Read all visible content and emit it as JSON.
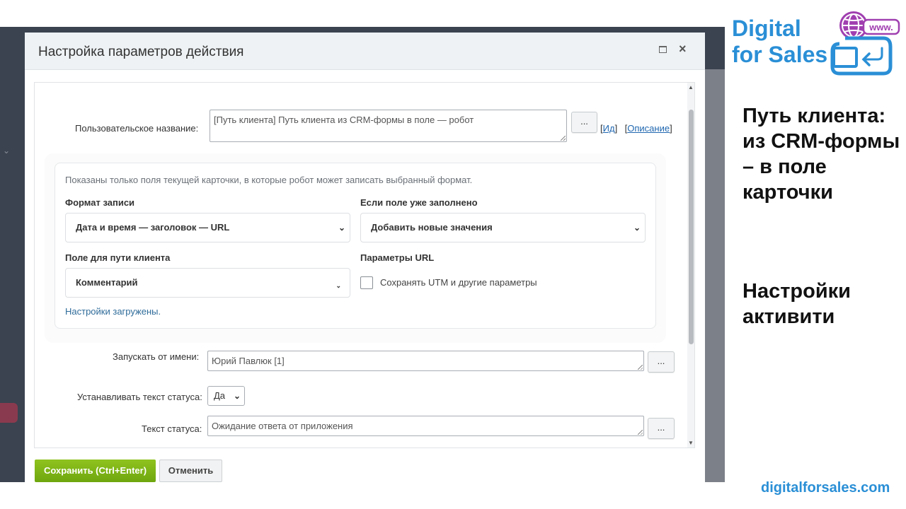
{
  "dialog": {
    "title": "Настройка параметров действия"
  },
  "form": {
    "custom_name": {
      "label": "Пользовательское название:",
      "value": "[Путь клиента] Путь клиента из CRM-формы в поле — робот",
      "dots": "...",
      "link_id": "Ид",
      "link_desc": "Описание"
    },
    "hint": "Показаны только поля текущей карточки, в которые робот может записать выбранный формат.",
    "record_format": {
      "label": "Формат записи",
      "value": "Дата и время — заголовок — URL"
    },
    "if_filled": {
      "label": "Если поле уже заполнено",
      "value": "Добавить новые значения"
    },
    "client_path_field": {
      "label": "Поле для пути клиента",
      "value": "Комментарий"
    },
    "url_params": {
      "label": "Параметры URL",
      "checkbox_label": "Сохранять UTM и другие параметры",
      "checked": false
    },
    "status_loaded": "Настройки загружены.",
    "run_as": {
      "label": "Запускать от имени:",
      "value": "Юрий Павлюк [1]",
      "dots": "..."
    },
    "set_status_text": {
      "label": "Устанавливать текст статуса:",
      "value": "Да"
    },
    "status_text": {
      "label": "Текст статуса:",
      "value": "Ожидание ответа от приложения",
      "dots": "..."
    }
  },
  "footer": {
    "save_label": "Сохранить (Ctrl+Enter)",
    "cancel_label": "Отменить"
  },
  "brand": {
    "line1": "Digital",
    "line2": "for Sales",
    "logo_badge": "www.",
    "site": "digitalforsales.com"
  },
  "side": {
    "heading": "Путь клиента: из CRM-формы – в поле карточки",
    "sub": "Настройки активити"
  },
  "colors": {
    "accent_blue": "#2a8fd6",
    "save_green": "#7ab317",
    "logo_purple": "#a03fb0"
  }
}
